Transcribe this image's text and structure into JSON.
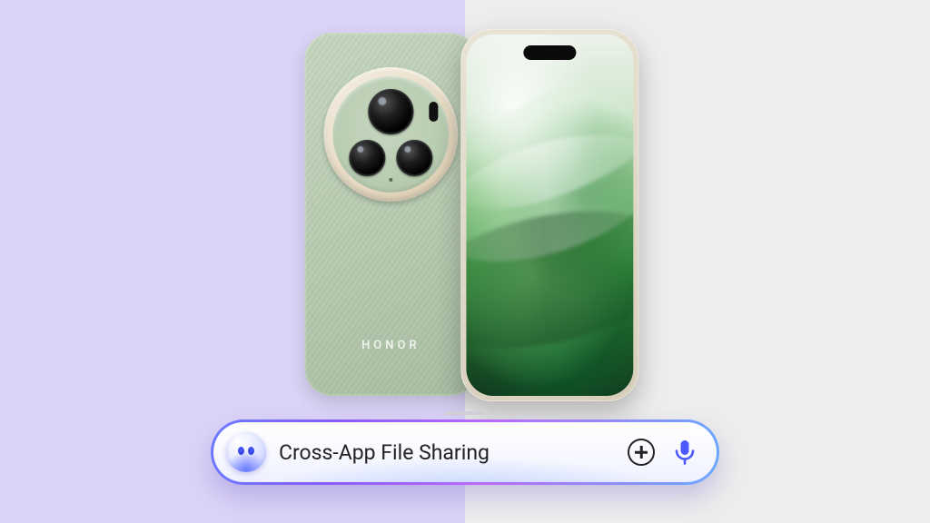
{
  "brand_logo": "HONOR",
  "assistant": {
    "text": "Cross-App File Sharing",
    "avatar_name": "assistant-avatar",
    "add_name": "add",
    "mic_name": "microphone",
    "mic_color": "#4a5aff"
  },
  "colors": {
    "bg_left": "#dcd4f7",
    "bg_right": "#ededed",
    "phone_back": "#b7ccb1",
    "pill_gradient_start": "#6a7bff",
    "pill_gradient_end": "#6aa8ff"
  }
}
